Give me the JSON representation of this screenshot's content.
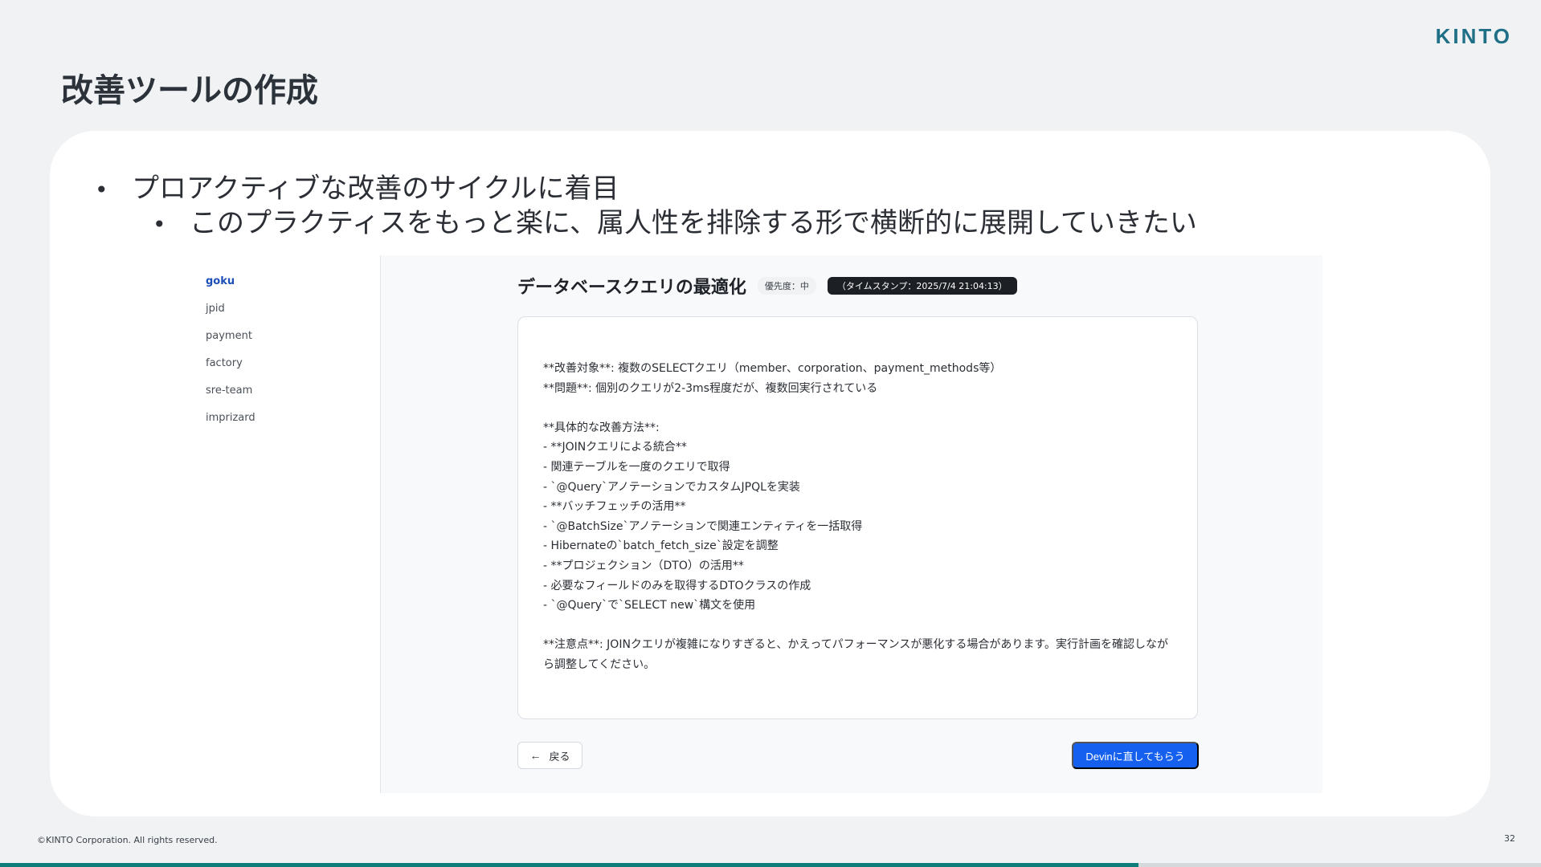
{
  "brand": {
    "logo": "KINTO"
  },
  "slide": {
    "title": "改善ツールの作成",
    "bullet_1": "プロアクティブな改善のサイクルに着目",
    "bullet_2": "このプラクティスをもっと楽に、属人性を排除する形で横断的に展開していきたい"
  },
  "screenshot": {
    "sidebar": {
      "items": [
        {
          "label": "goku",
          "active": true
        },
        {
          "label": "jpid",
          "active": false
        },
        {
          "label": "payment",
          "active": false
        },
        {
          "label": "factory",
          "active": false
        },
        {
          "label": "sre-team",
          "active": false
        },
        {
          "label": "imprizard",
          "active": false
        }
      ]
    },
    "task": {
      "title": "データベースクエリの最適化",
      "priority": "優先度：中",
      "timestamp": "（タイムスタンプ：2025/7/4 21:04:13）",
      "lines": [
        "**改善対象**: 複数のSELECTクエリ（member、corporation、payment_methods等）",
        "**問題**: 個別のクエリが2-3ms程度だが、複数回実行されている",
        "",
        "**具体的な改善方法**:",
        "- **JOINクエリによる統合**",
        "- 関連テーブルを一度のクエリで取得",
        "- `@Query`アノテーションでカスタムJPQLを実装",
        "- **バッチフェッチの活用**",
        "- `@BatchSize`アノテーションで関連エンティティを一括取得",
        "- Hibernateの`batch_fetch_size`設定を調整",
        "- **プロジェクション（DTO）の活用**",
        "- 必要なフィールドのみを取得するDTOクラスの作成",
        "- `@Query`で`SELECT new`構文を使用",
        ""
      ],
      "note": "**注意点**: JOINクエリが複雑になりすぎると、かえってパフォーマンスが悪化する場合があります。実行計画を確認しながら調整してください。"
    },
    "buttons": {
      "back": "戻る",
      "devin": "Devinに直してもらう"
    }
  },
  "footer": {
    "copyright": "©KINTO Corporation. All rights reserved.",
    "page_number": "32"
  },
  "progress": 0.739,
  "colors": {
    "brand": "#1f6f86",
    "accent": "#1660f0",
    "progress": "#0f7d7a"
  }
}
